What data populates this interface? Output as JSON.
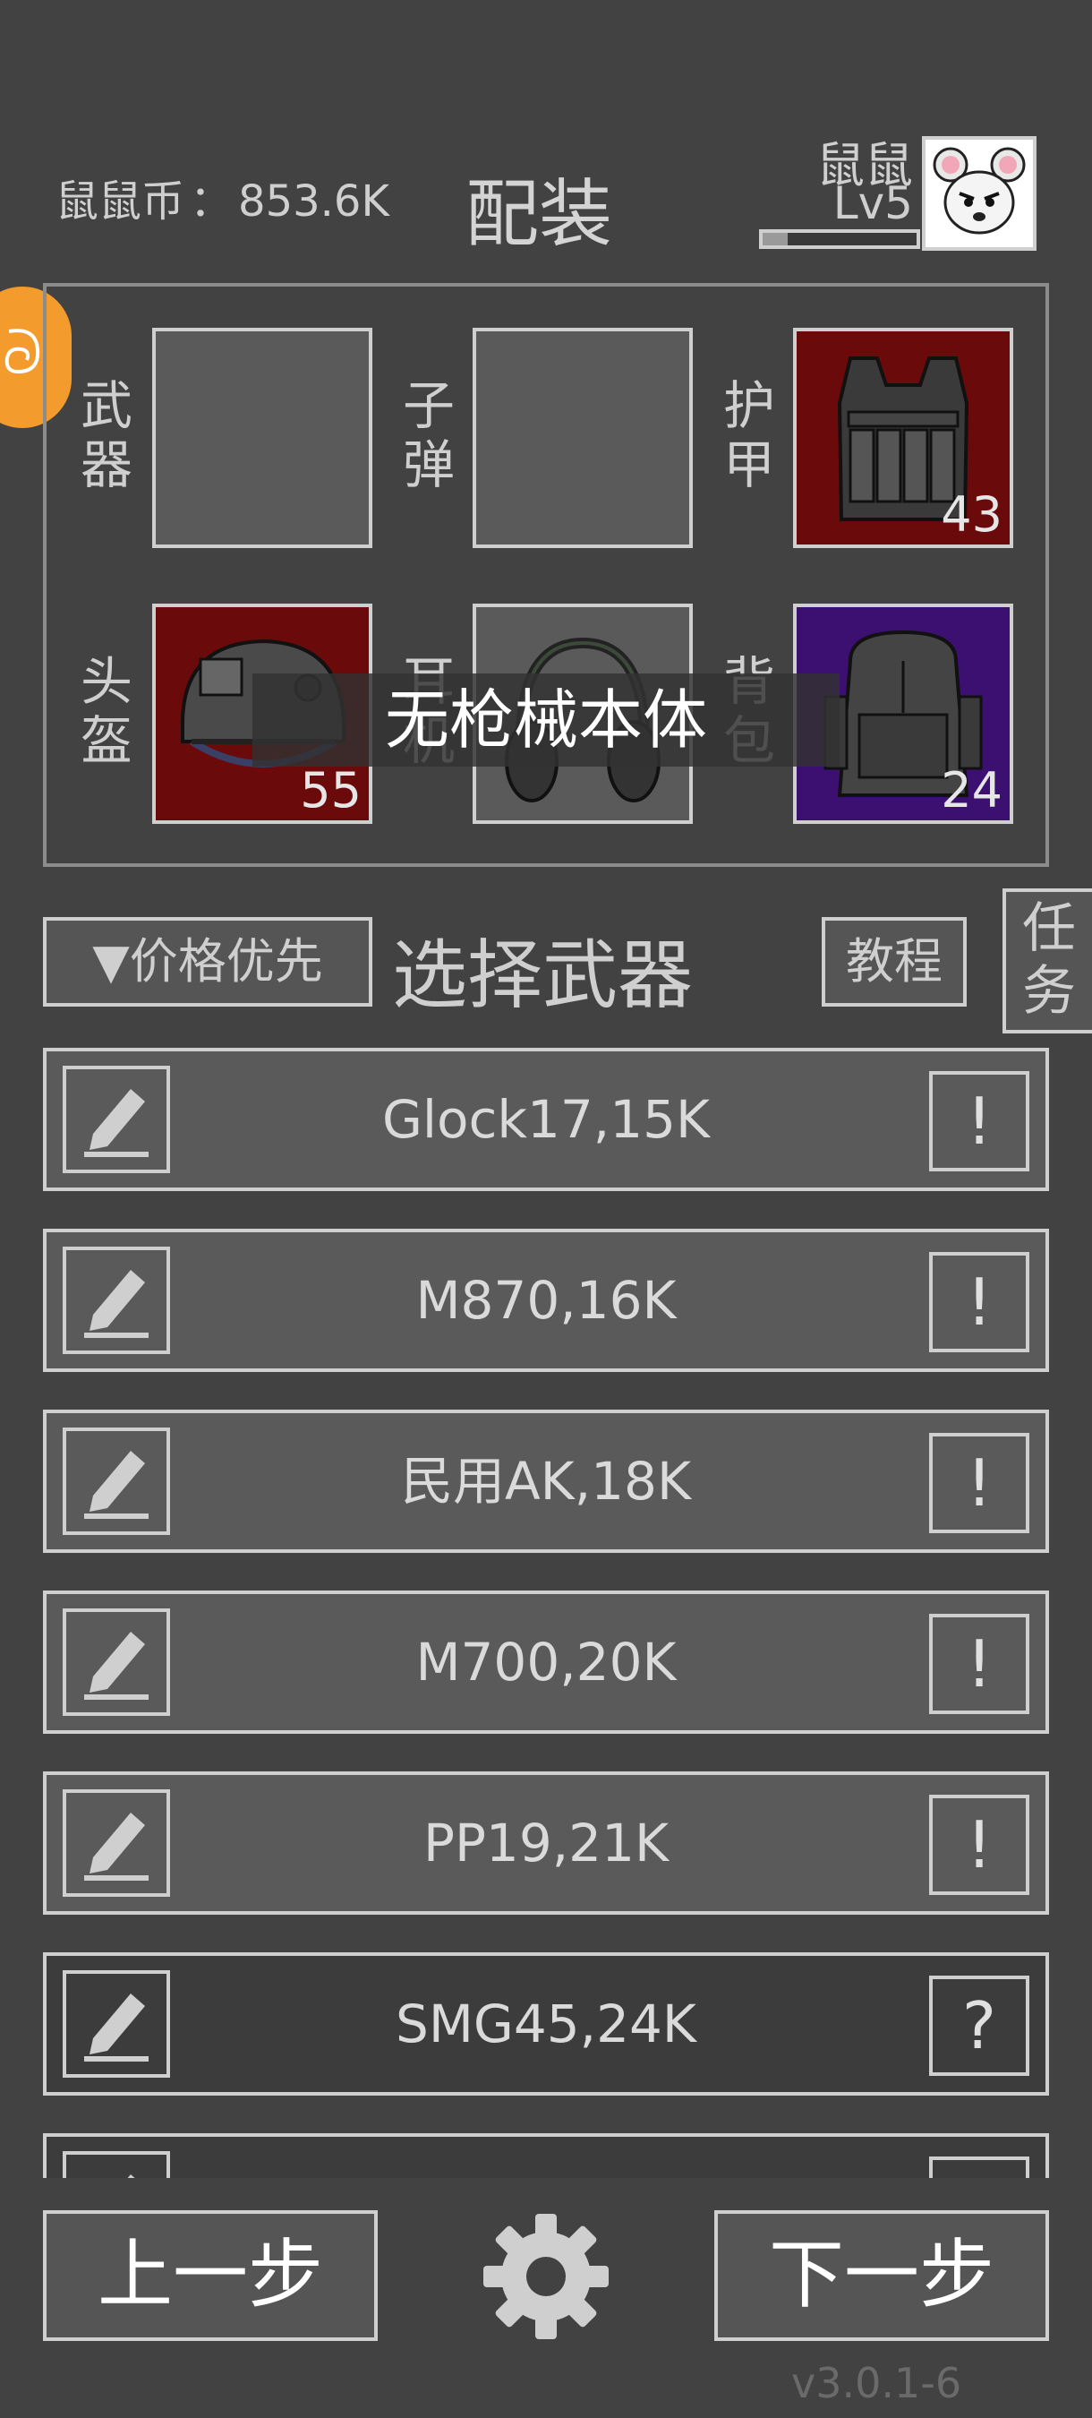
{
  "header": {
    "currency_label": "鼠鼠币",
    "currency_sep": "：",
    "currency_value": "853.6K",
    "title": "配装",
    "player_name": "鼠鼠",
    "player_level": "Lv5",
    "xp_fraction": 0.16
  },
  "loadout": {
    "slots": [
      {
        "label_top": "武",
        "label_bottom": "器",
        "count": ""
      },
      {
        "label_top": "子",
        "label_bottom": "弹",
        "count": ""
      },
      {
        "label_top": "护",
        "label_bottom": "甲",
        "count": "43"
      },
      {
        "label_top": "头",
        "label_bottom": "盔",
        "count": "55"
      },
      {
        "label_top": "耳",
        "label_bottom": "机",
        "count": ""
      },
      {
        "label_top": "背",
        "label_bottom": "包",
        "count": "24"
      }
    ],
    "toast": "无枪械本体"
  },
  "controls": {
    "sort_label": "▼价格优先",
    "section_title": "选择武器",
    "tutorial_label": "教程",
    "task_label_1": "任",
    "task_label_2": "务"
  },
  "weapons": [
    {
      "name": "Glock17,15K",
      "badge": "!"
    },
    {
      "name": "M870,16K",
      "badge": "!"
    },
    {
      "name": "民用AK,18K",
      "badge": "!"
    },
    {
      "name": "M700,20K",
      "badge": "!"
    },
    {
      "name": "PP19,21K",
      "badge": "!"
    },
    {
      "name": "SMG45,24K",
      "badge": "?"
    },
    {
      "name": "",
      "badge": "?"
    }
  ],
  "footer": {
    "prev_label": "上一步",
    "next_label": "下一步",
    "version": "v3.0.1-6"
  },
  "colors": {
    "background": "#424242",
    "armor_slot": "#6a0a0a",
    "backpack_slot": "#3c1070",
    "side_badge": "#f39b2c"
  }
}
